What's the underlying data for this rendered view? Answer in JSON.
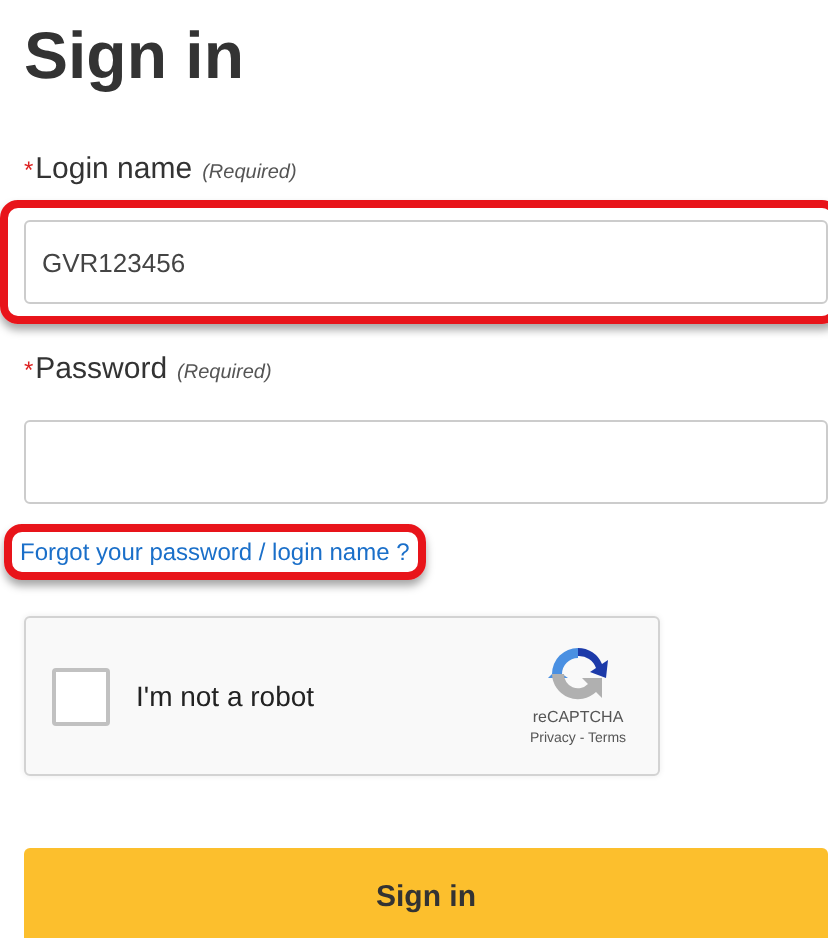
{
  "title": "Sign in",
  "fields": [
    {
      "label": "Login name",
      "required_mark": "*",
      "hint": "(Required)",
      "value": "GVR123456",
      "highlighted": true
    },
    {
      "label": "Password",
      "required_mark": "*",
      "hint": "(Required)",
      "highlighted": false
    }
  ],
  "forgot_link": {
    "text": "Forgot your password / login name ?",
    "highlighted": true
  },
  "captcha": {
    "label": "I'm not a robot",
    "checked": false,
    "brand": "reCAPTCHA",
    "privacy": "Privacy",
    "separator": "-",
    "terms": "Terms"
  },
  "submit": "Sign in"
}
